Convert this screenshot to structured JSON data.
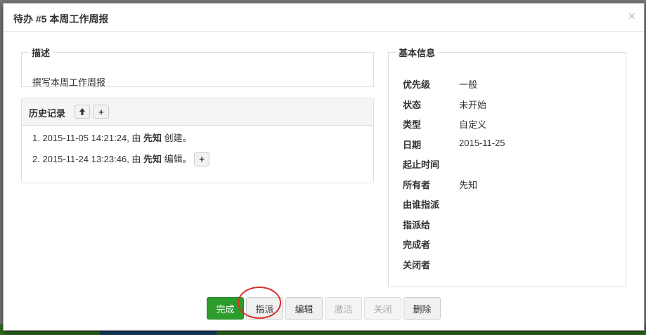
{
  "modal": {
    "title": "待办 #5 本周工作周报",
    "close_icon": "×"
  },
  "description": {
    "legend": "描述",
    "text": "撰写本周工作周报"
  },
  "history": {
    "title": "历史记录",
    "up_icon": "🡅",
    "plus_icon": "+",
    "items": [
      {
        "prefix": "1. 2015-11-05 14:21:24, 由 ",
        "user": "先知",
        "action": " 创建。"
      },
      {
        "prefix": "2. 2015-11-24 13:23:46, 由 ",
        "user": "先知",
        "action": " 编辑。"
      }
    ]
  },
  "info": {
    "legend": "基本信息",
    "rows": [
      {
        "label": "优先级",
        "value": "一般"
      },
      {
        "label": "状态",
        "value": "未开始"
      },
      {
        "label": "类型",
        "value": "自定义"
      },
      {
        "label": "日期",
        "value": "2015-11-25"
      },
      {
        "label": "起止时间",
        "value": ""
      },
      {
        "label": "所有者",
        "value": "先知"
      },
      {
        "label": "由谁指派",
        "value": ""
      },
      {
        "label": "指派给",
        "value": ""
      },
      {
        "label": "完成者",
        "value": ""
      },
      {
        "label": "关闭者",
        "value": ""
      }
    ]
  },
  "footer": {
    "finish": "完成",
    "assign": "指派",
    "edit": "编辑",
    "activate": "激活",
    "close": "关闭",
    "delete": "删除"
  },
  "colors": {
    "primary": "#2c9d2c",
    "highlight": "#d9302a"
  }
}
